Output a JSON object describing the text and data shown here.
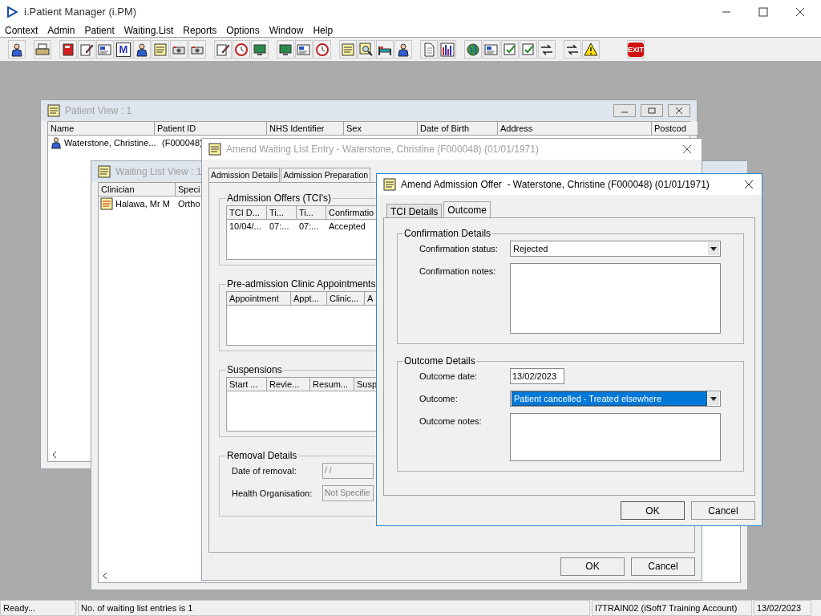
{
  "app": {
    "title": "i.Patient Manager (i.PM)"
  },
  "menu": [
    "Context",
    "Admin",
    "Patient",
    "Waiting.List",
    "Reports",
    "Options",
    "Window",
    "Help"
  ],
  "toolbar": [
    [
      {
        "kind": "person"
      }
    ],
    [
      {
        "kind": "printer"
      }
    ],
    [
      {
        "kind": "book"
      },
      {
        "kind": "pencil"
      },
      {
        "kind": "card"
      },
      {
        "kind": "letter",
        "label": "M"
      },
      {
        "kind": "person"
      },
      {
        "kind": "note"
      },
      {
        "kind": "camera"
      },
      {
        "kind": "camera"
      }
    ],
    [
      {
        "kind": "pencil"
      },
      {
        "kind": "clock"
      },
      {
        "kind": "screen"
      }
    ],
    [
      {
        "kind": "screen"
      },
      {
        "kind": "card"
      },
      {
        "kind": "clock"
      }
    ],
    [
      {
        "kind": "note"
      },
      {
        "kind": "magnifier"
      },
      {
        "kind": "bed"
      },
      {
        "kind": "person"
      }
    ],
    [
      {
        "kind": "page"
      },
      {
        "kind": "bars"
      }
    ],
    [
      {
        "kind": "globe"
      },
      {
        "kind": "card"
      },
      {
        "kind": "check"
      },
      {
        "kind": "check"
      },
      {
        "kind": "arrows"
      }
    ],
    [
      {
        "kind": "arrows"
      },
      {
        "kind": "warning"
      }
    ],
    [
      {
        "kind": "exit",
        "label": "EXIT"
      }
    ]
  ],
  "patient_view": {
    "title": "Patient View : 1",
    "active": false,
    "columns": [
      "Name",
      "Patient ID",
      "NHS Identifier",
      "Sex",
      "Date of Birth",
      "Address",
      "Postcod"
    ],
    "rows": [
      {
        "cells": [
          "Waterstone, Christine...",
          "(F000048)"
        ]
      }
    ]
  },
  "waiting_list_view": {
    "title": "Waiting List View : 1",
    "active": false,
    "columns": [
      "Clinician",
      "Speci"
    ],
    "rows": [
      {
        "cells": [
          "Halawa, Mr M",
          "Ortho"
        ]
      }
    ]
  },
  "amend_waiting_list_entry": {
    "title": "Amend Waiting List Entry - Waterstone, Christine (F000048) (01/01/1971)",
    "active": false,
    "tabs": [
      {
        "label": "Admission Details",
        "selected": false
      },
      {
        "label": "Admission Preparation",
        "selected": false
      }
    ],
    "tables": [
      {
        "label": "Admission Offers (TCI's)",
        "columns": [
          "TCI D...",
          "Ti...",
          "Ti...",
          "Confirmatio"
        ],
        "rows": [
          {
            "cells": [
              "10/04/...",
              "07:...",
              "07:...",
              "Accepted"
            ]
          }
        ]
      },
      {
        "label": "Pre-admission Clinic Appointments",
        "columns": [
          "Appointment",
          "Appt...",
          "Clinic...",
          "A"
        ]
      },
      {
        "label": "Suspensions",
        "columns": [
          "Start ...",
          "Revie...",
          "Resum...",
          "Susp"
        ]
      }
    ],
    "removal": {
      "label": "Removal Details",
      "fields": [
        {
          "label": "Date of removal:",
          "value": "/ /",
          "disabled": true
        },
        {
          "label": "Health Organisation:",
          "value": "Not Specifie",
          "disabled": true
        }
      ]
    },
    "buttons": [
      "OK",
      "Cancel"
    ]
  },
  "amend_admission_offer": {
    "title": "Amend Admission Offer  - Waterstone, Christine (F000048) (01/01/1971)",
    "active": true,
    "tabs": [
      {
        "label": "TCI Details",
        "selected": false
      },
      {
        "label": "Outcome",
        "selected": true
      }
    ],
    "groups": [
      {
        "label": "Confirmation Details",
        "fields": [
          {
            "kind": "select",
            "label": "Confirmation status:",
            "value": "Rejected",
            "focused": false
          },
          {
            "kind": "textarea",
            "label": "Confirmation notes:"
          }
        ]
      },
      {
        "label": "Outcome Details",
        "fields": [
          {
            "kind": "date",
            "label": "Outcome date:",
            "value": "13/02/2023"
          },
          {
            "kind": "select",
            "label": "Outcome:",
            "value": "Patient cancelled - Treated elsewhere",
            "focused": true
          },
          {
            "kind": "textarea",
            "label": "Outcome notes:"
          }
        ]
      }
    ],
    "buttons": [
      "OK",
      "Cancel"
    ]
  },
  "status_bar": [
    "Ready...",
    "No. of waiting list entries is 1",
    "I7TRAIN02 (iSoft7 Training Account)",
    "13/02/2023"
  ]
}
